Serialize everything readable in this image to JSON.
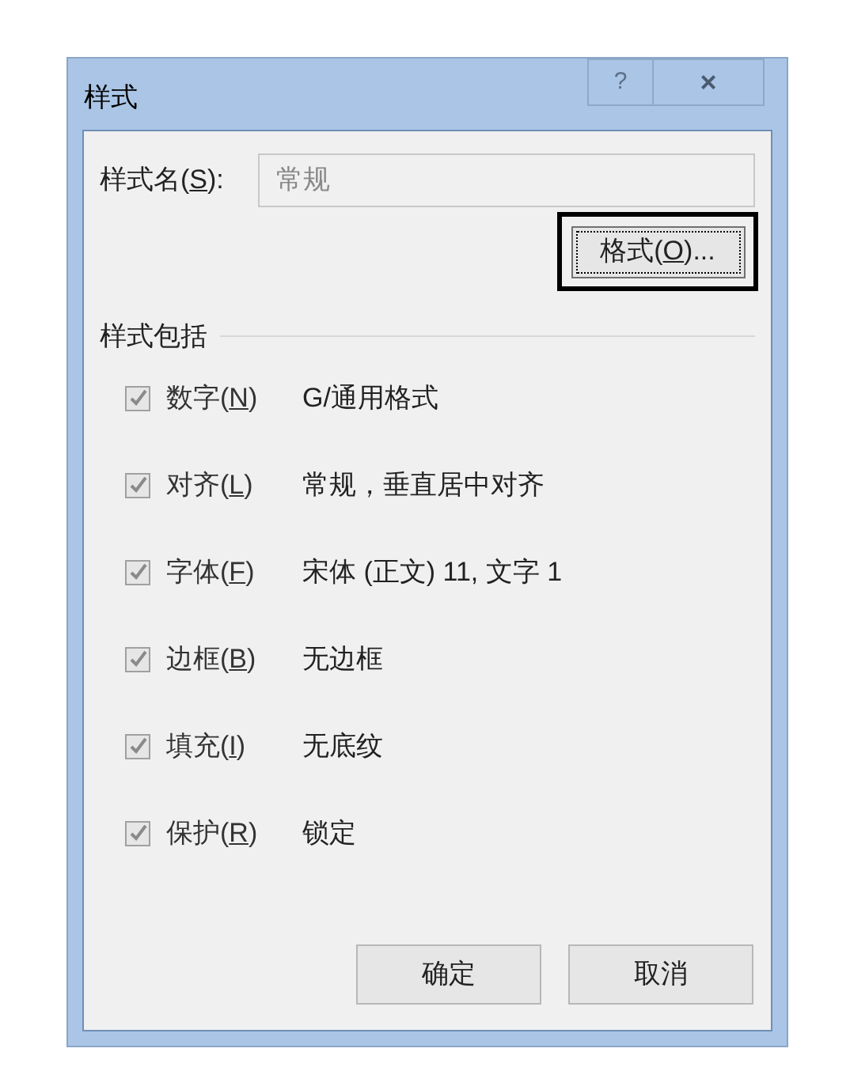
{
  "window": {
    "title": "样式",
    "help_button": "?",
    "close_button": "×"
  },
  "style_name": {
    "label_prefix": "样式名(",
    "access_key": "S",
    "label_suffix": "):",
    "value": "常规",
    "disabled": true
  },
  "format_button": {
    "label_prefix": "格式(",
    "access_key": "O",
    "label_suffix": ")...",
    "focused": true
  },
  "includes": {
    "title": "样式包括",
    "items": [
      {
        "label_prefix": "数字(",
        "access_key": "N",
        "label_suffix": ")",
        "value": "G/通用格式",
        "checked": true,
        "disabled": true
      },
      {
        "label_prefix": "对齐(",
        "access_key": "L",
        "label_suffix": ")",
        "value": "常规，垂直居中对齐",
        "checked": true,
        "disabled": true
      },
      {
        "label_prefix": "字体(",
        "access_key": "F",
        "label_suffix": ")",
        "value": "宋体 (正文) 11, 文字 1",
        "checked": true,
        "disabled": true
      },
      {
        "label_prefix": "边框(",
        "access_key": "B",
        "label_suffix": ")",
        "value": "无边框",
        "checked": true,
        "disabled": true
      },
      {
        "label_prefix": "填充(",
        "access_key": "I",
        "label_suffix": ")",
        "value": "无底纹",
        "checked": true,
        "disabled": true
      },
      {
        "label_prefix": "保护(",
        "access_key": "R",
        "label_suffix": ")",
        "value": "锁定",
        "checked": true,
        "disabled": true
      }
    ]
  },
  "buttons": [
    "确定",
    "取消"
  ]
}
